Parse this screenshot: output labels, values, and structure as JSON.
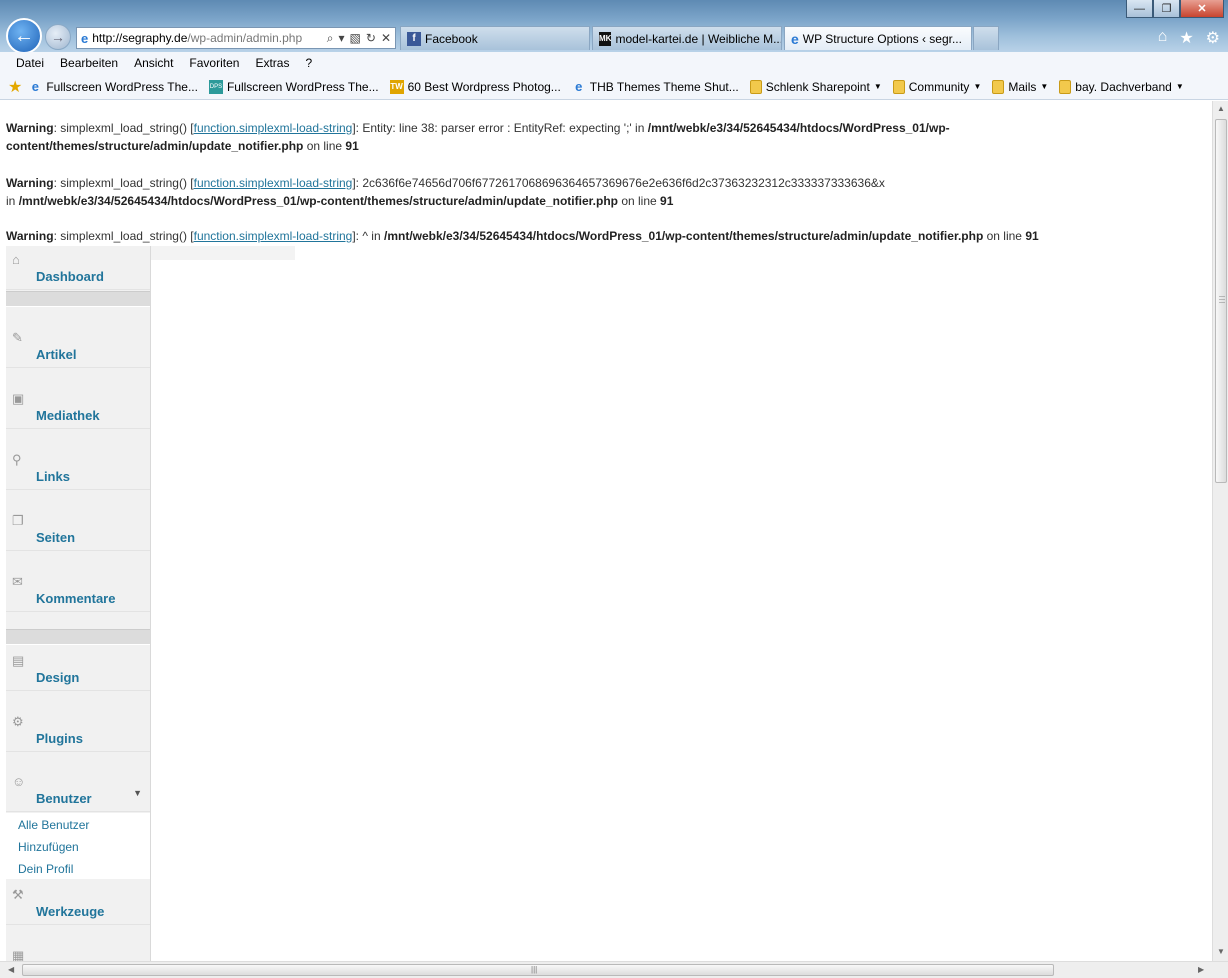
{
  "browser": {
    "controls": {
      "minimize": "—",
      "maximize": "❐",
      "close": "✕"
    },
    "back": "←",
    "forward": "→",
    "address": {
      "domain": "http://segraphy.de",
      "path": "/wp-admin/admin.php",
      "icons": [
        "search-icon",
        "dropdown-icon",
        "compat-icon",
        "refresh-icon",
        "stop-icon"
      ]
    },
    "tabs": [
      {
        "label": "Facebook",
        "icon": "f"
      },
      {
        "label": "model-kartei.de | Weibliche M...",
        "icon": "MK"
      },
      {
        "label": "WP Structure Options ‹ segr...",
        "icon": "e",
        "close": "✕"
      }
    ],
    "right_icons": [
      "home-icon",
      "favorites-star-icon",
      "gear-icon"
    ],
    "menu": [
      "Datei",
      "Bearbeiten",
      "Ansicht",
      "Favoriten",
      "Extras",
      "?"
    ],
    "favorites": [
      {
        "label": "Fullscreen WordPress The...",
        "icon": "ie"
      },
      {
        "label": "Fullscreen WordPress The...",
        "icon": "ds"
      },
      {
        "label": "60 Best Wordpress Photog...",
        "icon": "tw"
      },
      {
        "label": "THB Themes  Theme Shut...",
        "icon": "ie"
      },
      {
        "label": "Schlenk Sharepoint",
        "icon": "folder",
        "dropdown": true
      },
      {
        "label": "Community",
        "icon": "folder",
        "dropdown": true
      },
      {
        "label": "Mails",
        "icon": "folder",
        "dropdown": true
      },
      {
        "label": "bay. Dachverband",
        "icon": "folder",
        "dropdown": true
      }
    ]
  },
  "warnings": [
    {
      "label": "Warning",
      "text1": ": simplexml_load_string() [",
      "link": "function.simplexml-load-string",
      "text2": "]: Entity: line 38: parser error : EntityRef: expecting ';' in ",
      "path": "/mnt/webk/e3/34/52645434/htdocs/WordPress_01/wp-content/themes/structure/admin/update_notifier.php",
      "text3": " on line ",
      "line": "91"
    },
    {
      "label": "Warning",
      "text1": ": simplexml_load_string() [",
      "link": "function.simplexml-load-string",
      "text2": "]: 2c636f6e74656d706f6772617068696364657369676e2e636f6d2c37363232312c333337333636&x",
      "text2b": "in ",
      "path": "/mnt/webk/e3/34/52645434/htdocs/WordPress_01/wp-content/themes/structure/admin/update_notifier.php",
      "text3": " on line ",
      "line": "91"
    },
    {
      "label": "Warning",
      "text1": ": simplexml_load_string() [",
      "link": "function.simplexml-load-string",
      "text2": "]: ^ in ",
      "path": "/mnt/webk/e3/34/52645434/htdocs/WordPress_01/wp-content/themes/structure/admin/update_notifier.php",
      "text3": " on line ",
      "line": "91"
    }
  ],
  "sidebar": {
    "items": [
      {
        "label": "Dashboard",
        "icon": "⌂"
      },
      {
        "label": "Artikel",
        "icon": "✎"
      },
      {
        "label": "Mediathek",
        "icon": "▣"
      },
      {
        "label": "Links",
        "icon": "⚲"
      },
      {
        "label": "Seiten",
        "icon": "❐"
      },
      {
        "label": "Kommentare",
        "icon": "✉"
      },
      {
        "label": "Design",
        "icon": "▤"
      },
      {
        "label": "Plugins",
        "icon": "⚙"
      },
      {
        "label": "Benutzer",
        "icon": "☺",
        "toggle": "▼"
      },
      {
        "label": "Werkzeuge",
        "icon": "⚒"
      }
    ],
    "submenu": [
      "Alle Benutzer",
      "Hinzufügen",
      "Dein Profil"
    ]
  }
}
